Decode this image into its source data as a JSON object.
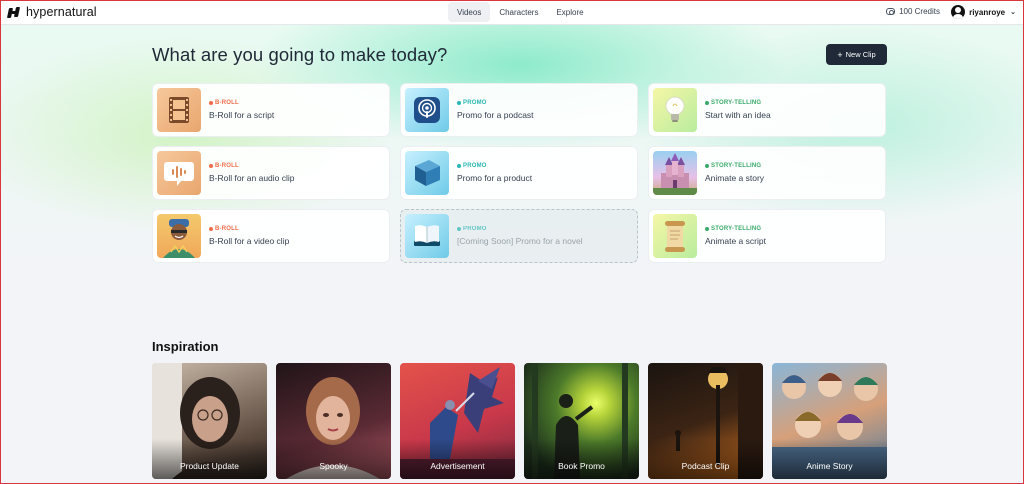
{
  "brand": {
    "name": "hypernatural"
  },
  "nav": {
    "items": [
      {
        "label": "Videos",
        "active": true
      },
      {
        "label": "Characters",
        "active": false
      },
      {
        "label": "Explore",
        "active": false
      }
    ]
  },
  "account": {
    "credits": "100 Credits",
    "username": "riyanroye"
  },
  "hero": {
    "headline": "What are you going to make today?",
    "new_clip_label": "New Clip"
  },
  "cards": [
    {
      "tag": "B-ROLL",
      "title": "B-Roll for a script",
      "icon": "film-strip-icon"
    },
    {
      "tag": "PROMO",
      "title": "Promo for a podcast",
      "icon": "podcast-icon"
    },
    {
      "tag": "STORY-TELLING",
      "title": "Start with an idea",
      "icon": "lightbulb-icon"
    },
    {
      "tag": "B-ROLL",
      "title": "B-Roll for an audio clip",
      "icon": "audio-bubble-icon"
    },
    {
      "tag": "PROMO",
      "title": "Promo for a product",
      "icon": "product-box-icon"
    },
    {
      "tag": "STORY-TELLING",
      "title": "Animate a story",
      "icon": "castle-icon"
    },
    {
      "tag": "B-ROLL",
      "title": "B-Roll for a video clip",
      "icon": "person-portrait-icon"
    },
    {
      "tag": "PROMO",
      "title": "[Coming Soon] Promo for a novel",
      "icon": "book-icon"
    },
    {
      "tag": "STORY-TELLING",
      "title": "Animate a script",
      "icon": "scroll-icon"
    }
  ],
  "inspiration": {
    "title": "Inspiration",
    "items": [
      {
        "label": "Product Update"
      },
      {
        "label": "Spooky"
      },
      {
        "label": "Advertisement"
      },
      {
        "label": "Book Promo"
      },
      {
        "label": "Podcast Clip"
      },
      {
        "label": "Anime Story"
      }
    ]
  },
  "colors": {
    "broll": "#ef6c4a",
    "promo": "#2bb6b4",
    "story": "#3aaa6b",
    "button": "#1f2937"
  }
}
